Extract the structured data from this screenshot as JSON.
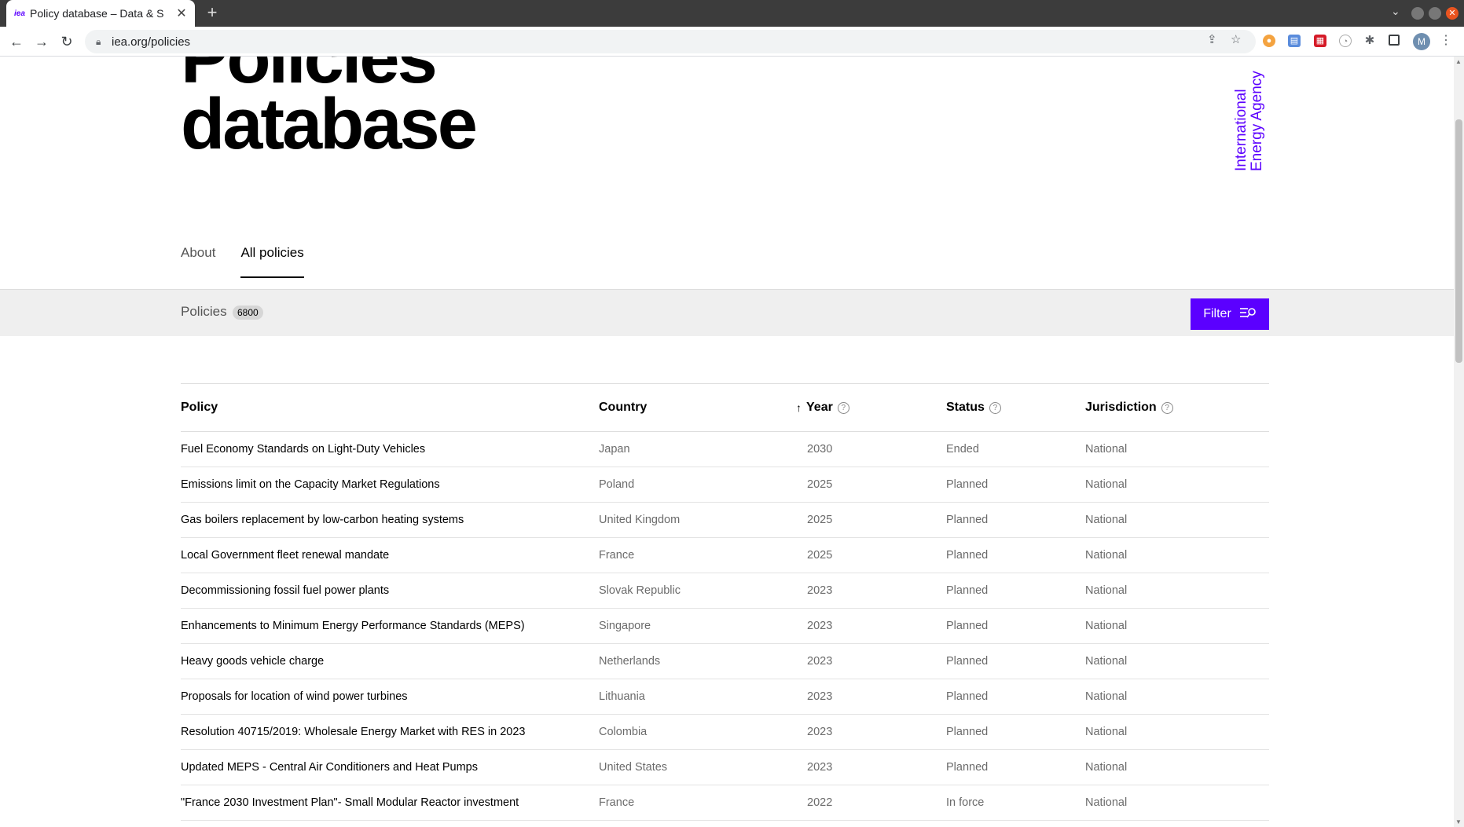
{
  "browser": {
    "tab_title": "Policy database – Data & S",
    "tab_favicon": "iea",
    "url": "iea.org/policies",
    "avatar": "M"
  },
  "page": {
    "title_line1": "Policies",
    "title_line2": "database",
    "logo_line1": "International",
    "logo_line2": "Energy Agency"
  },
  "tabs": [
    {
      "label": "About",
      "active": false
    },
    {
      "label": "All policies",
      "active": true
    }
  ],
  "filter_bar": {
    "label": "Policies",
    "count": "6800",
    "filter_label": "Filter"
  },
  "table": {
    "columns": {
      "policy": "Policy",
      "country": "Country",
      "year": "Year",
      "status": "Status",
      "jurisdiction": "Jurisdiction"
    },
    "rows": [
      {
        "policy": "Fuel Economy Standards on Light-Duty Vehicles",
        "country": "Japan",
        "year": "2030",
        "status": "Ended",
        "jurisdiction": "National"
      },
      {
        "policy": "Emissions limit on the Capacity Market Regulations",
        "country": "Poland",
        "year": "2025",
        "status": "Planned",
        "jurisdiction": "National"
      },
      {
        "policy": "Gas boilers replacement by low-carbon heating systems",
        "country": "United Kingdom",
        "year": "2025",
        "status": "Planned",
        "jurisdiction": "National"
      },
      {
        "policy": "Local Government fleet renewal mandate",
        "country": "France",
        "year": "2025",
        "status": "Planned",
        "jurisdiction": "National"
      },
      {
        "policy": "Decommissioning fossil fuel power plants",
        "country": "Slovak Republic",
        "year": "2023",
        "status": "Planned",
        "jurisdiction": "National"
      },
      {
        "policy": "Enhancements to Minimum Energy Performance Standards (MEPS)",
        "country": "Singapore",
        "year": "2023",
        "status": "Planned",
        "jurisdiction": "National"
      },
      {
        "policy": "Heavy goods vehicle charge",
        "country": "Netherlands",
        "year": "2023",
        "status": "Planned",
        "jurisdiction": "National"
      },
      {
        "policy": "Proposals for location of wind power turbines",
        "country": "Lithuania",
        "year": "2023",
        "status": "Planned",
        "jurisdiction": "National"
      },
      {
        "policy": "Resolution 40715/2019: Wholesale Energy Market with RES in 2023",
        "country": "Colombia",
        "year": "2023",
        "status": "Planned",
        "jurisdiction": "National"
      },
      {
        "policy": "Updated MEPS - Central Air Conditioners and Heat Pumps",
        "country": "United States",
        "year": "2023",
        "status": "Planned",
        "jurisdiction": "National"
      },
      {
        "policy": "\"France 2030 Investment Plan\"- Small Modular Reactor investment",
        "country": "France",
        "year": "2022",
        "status": "In force",
        "jurisdiction": "National"
      }
    ]
  }
}
